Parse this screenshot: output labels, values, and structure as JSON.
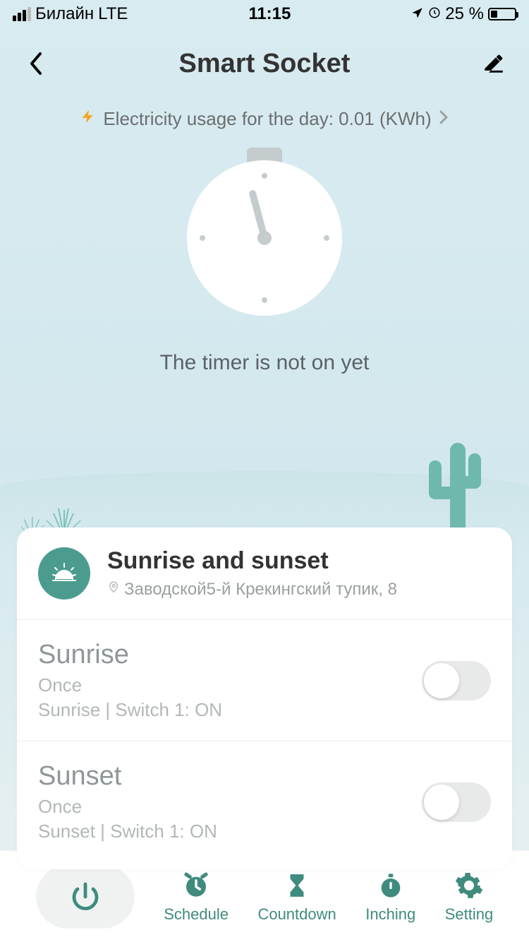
{
  "status": {
    "carrier": "Билайн",
    "network": "LTE",
    "time": "11:15",
    "battery": "25 %"
  },
  "header": {
    "title": "Smart Socket"
  },
  "usage": {
    "text": "Electricity usage for the day: 0.01 (KWh)"
  },
  "timer": {
    "status_text": "The timer is not on yet"
  },
  "card": {
    "title": "Sunrise and sunset",
    "location": "Заводской5-й Крекингский тупик, 8",
    "rows": [
      {
        "title": "Sunrise",
        "freq": "Once",
        "detail": "Sunrise  | Switch 1: ON"
      },
      {
        "title": "Sunset",
        "freq": "Once",
        "detail": "Sunset  | Switch 1: ON"
      }
    ]
  },
  "nav": {
    "schedule": "Schedule",
    "countdown": "Countdown",
    "inching": "Inching",
    "setting": "Setting"
  },
  "colors": {
    "accent": "#3f8b7d",
    "icon_bg": "#4b9c8e",
    "bolt": "#f5a623"
  }
}
